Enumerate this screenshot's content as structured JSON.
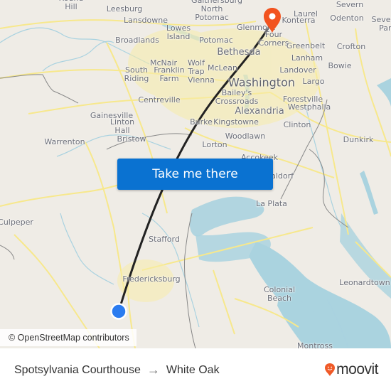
{
  "map": {
    "attribution": "© OpenStreetMap contributors",
    "cta_label": "Take me there",
    "origin_marker_color": "#2b7cf0",
    "destination_marker_color": "#f2531f",
    "route_line_color": "#222222",
    "water_color": "#aad3df",
    "road_color": "#f7e88c",
    "places": [
      {
        "name": "Round Hill",
        "size": "small"
      },
      {
        "name": "Leesburg",
        "size": "small"
      },
      {
        "name": "Lansdowne",
        "size": "small"
      },
      {
        "name": "Lowes Island",
        "size": "small"
      },
      {
        "name": "Broadlands",
        "size": "small"
      },
      {
        "name": "Gaithersburg",
        "size": "small"
      },
      {
        "name": "North Potomac",
        "size": "small"
      },
      {
        "name": "Potomac",
        "size": "small"
      },
      {
        "name": "McNair",
        "size": "small"
      },
      {
        "name": "Wolf Trap",
        "size": "small"
      },
      {
        "name": "South Riding",
        "size": "small"
      },
      {
        "name": "Franklin Farm",
        "size": "small"
      },
      {
        "name": "Vienna",
        "size": "small"
      },
      {
        "name": "McLean",
        "size": "small"
      },
      {
        "name": "Bethesda",
        "size": "medium"
      },
      {
        "name": "Glenmont",
        "size": "small"
      },
      {
        "name": "Four Corners",
        "size": "small"
      },
      {
        "name": "Laurel",
        "size": "small"
      },
      {
        "name": "Konterra",
        "size": "small"
      },
      {
        "name": "Severn",
        "size": "small"
      },
      {
        "name": "Odenton",
        "size": "small"
      },
      {
        "name": "Severna Park",
        "size": "small"
      },
      {
        "name": "Greenbelt",
        "size": "small"
      },
      {
        "name": "Crofton",
        "size": "small"
      },
      {
        "name": "Lanham",
        "size": "small"
      },
      {
        "name": "Bowie",
        "size": "small"
      },
      {
        "name": "Landover",
        "size": "small"
      },
      {
        "name": "Largo",
        "size": "small"
      },
      {
        "name": "Washington",
        "size": "large"
      },
      {
        "name": "Centreville",
        "size": "small"
      },
      {
        "name": "Bailey's Crossroads",
        "size": "small"
      },
      {
        "name": "Alexandria",
        "size": "medium"
      },
      {
        "name": "Forestville",
        "size": "small"
      },
      {
        "name": "Westphalia",
        "size": "small"
      },
      {
        "name": "Gainesville",
        "size": "small"
      },
      {
        "name": "Linton Hall",
        "size": "small"
      },
      {
        "name": "Bristow",
        "size": "small"
      },
      {
        "name": "Burke",
        "size": "small"
      },
      {
        "name": "Kingstowne",
        "size": "small"
      },
      {
        "name": "Clinton",
        "size": "small"
      },
      {
        "name": "Warrenton",
        "size": "small"
      },
      {
        "name": "Woodlawn",
        "size": "small"
      },
      {
        "name": "Lorton",
        "size": "small"
      },
      {
        "name": "Dunkirk",
        "size": "small"
      },
      {
        "name": "Accokeek",
        "size": "small"
      },
      {
        "name": "Waldorf",
        "size": "small"
      },
      {
        "name": "La Plata",
        "size": "small"
      },
      {
        "name": "Culpeper",
        "size": "small"
      },
      {
        "name": "Stafford",
        "size": "small"
      },
      {
        "name": "Fredericksburg",
        "size": "small"
      },
      {
        "name": "Colonial Beach",
        "size": "small"
      },
      {
        "name": "Leonardtown",
        "size": "small"
      },
      {
        "name": "Montross",
        "size": "small"
      }
    ]
  },
  "footer": {
    "origin": "Spotsylvania Courthouse",
    "arrow": "→",
    "destination": "White Oak",
    "brand": "moovit",
    "brand_color": "#f05a28"
  }
}
